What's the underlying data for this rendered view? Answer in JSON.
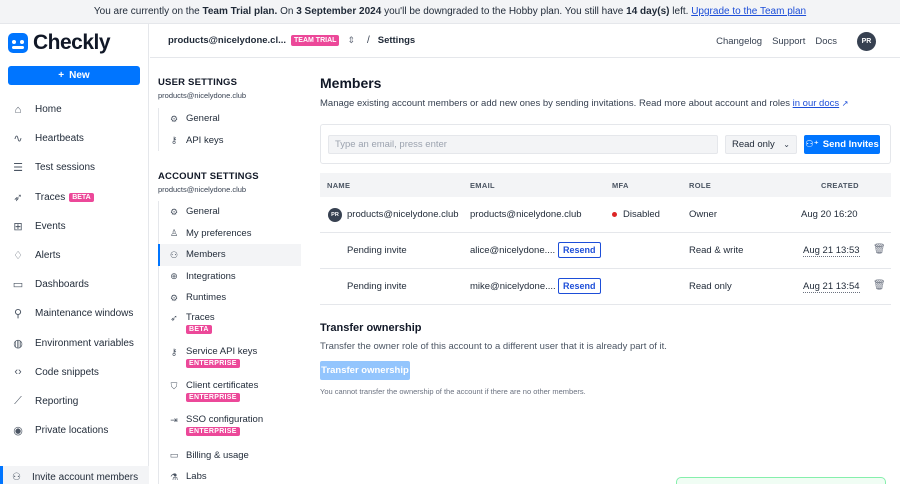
{
  "banner": {
    "prefix": "You are currently on the",
    "plan": "Team Trial plan.",
    "on": "On",
    "date": "3 September 2024",
    "middle": "you'll be downgraded to the Hobby plan. You still have",
    "days": "14 day(s)",
    "left": "left.",
    "upgrade_link": "Upgrade to the Team plan"
  },
  "brand": {
    "name": "Checkly"
  },
  "sidebar": {
    "new_label": "New",
    "items": [
      {
        "label": "Home",
        "icon": "home-icon"
      },
      {
        "label": "Heartbeats",
        "icon": "heartbeat-icon"
      },
      {
        "label": "Test sessions",
        "icon": "test-sessions-icon"
      },
      {
        "label": "Traces",
        "icon": "traces-icon",
        "badge": "BETA"
      },
      {
        "label": "Events",
        "icon": "events-icon"
      },
      {
        "label": "Alerts",
        "icon": "bell-icon"
      },
      {
        "label": "Dashboards",
        "icon": "dashboard-icon"
      },
      {
        "label": "Maintenance windows",
        "icon": "maintenance-icon"
      },
      {
        "label": "Environment variables",
        "icon": "globe-icon"
      },
      {
        "label": "Code snippets",
        "icon": "code-icon"
      },
      {
        "label": "Reporting",
        "icon": "chart-icon"
      },
      {
        "label": "Private locations",
        "icon": "location-icon"
      }
    ],
    "bottom": {
      "label": "Invite account members",
      "icon": "invite-user-icon"
    }
  },
  "header": {
    "account": "products@nicelydone.cl...",
    "trial_badge": "TEAM TRIAL",
    "separator": "/",
    "breadcrumb": "Settings",
    "links": [
      "Changelog",
      "Support",
      "Docs"
    ],
    "avatar": "PR"
  },
  "subnav": {
    "user_title": "USER SETTINGS",
    "user_email": "products@nicelydone.club",
    "user_items": [
      {
        "label": "General",
        "icon": "gear-icon"
      },
      {
        "label": "API keys",
        "icon": "key-icon"
      }
    ],
    "account_title": "ACCOUNT SETTINGS",
    "account_email": "products@nicelydone.club",
    "account_items": [
      {
        "label": "General",
        "icon": "gear-icon"
      },
      {
        "label": "My preferences",
        "icon": "user-icon"
      },
      {
        "label": "Members",
        "icon": "members-icon",
        "active": true
      },
      {
        "label": "Integrations",
        "icon": "integrations-icon"
      },
      {
        "label": "Runtimes",
        "icon": "runtimes-icon"
      },
      {
        "label": "Traces",
        "icon": "traces-icon",
        "badge": "BETA"
      },
      {
        "label": "Service API keys",
        "icon": "key-icon",
        "badge": "ENTERPRISE"
      },
      {
        "label": "Client certificates",
        "icon": "certificate-icon",
        "badge": "ENTERPRISE"
      },
      {
        "label": "SSO configuration",
        "icon": "sso-icon",
        "badge": "ENTERPRISE"
      },
      {
        "label": "Billing & usage",
        "icon": "credit-card-icon"
      },
      {
        "label": "Labs",
        "icon": "labs-icon"
      }
    ]
  },
  "members": {
    "title": "Members",
    "description": "Manage existing account members or add new ones by sending invitations. Read more about account and roles",
    "docs_link": "in our docs",
    "email_placeholder": "Type an email, press enter",
    "role_selected": "Read only",
    "send_label": "Send Invites",
    "columns": {
      "name": "NAME",
      "email": "EMAIL",
      "mfa": "MFA",
      "role": "ROLE",
      "created": "CREATED"
    },
    "rows": [
      {
        "avatar": "PR",
        "name": "products@nicelydone.club",
        "email": "products@nicelydone.club",
        "mfa": "Disabled",
        "role": "Owner",
        "created": "Aug 20 16:20"
      },
      {
        "name": "Pending invite",
        "email": "alice@nicelydone....",
        "resend": "Resend",
        "role": "Read & write",
        "created": "Aug 21 13:53"
      },
      {
        "name": "Pending invite",
        "email": "mike@nicelydone....",
        "resend": "Resend",
        "role": "Read only",
        "created": "Aug 21 13:54"
      }
    ]
  },
  "transfer": {
    "title": "Transfer ownership",
    "description": "Transfer the owner role of this account to a different user that it is already part of it.",
    "button": "Transfer ownership",
    "note": "You cannot transfer the ownership of the account if there are no other members."
  },
  "colors": {
    "accent": "#0075ff",
    "badge": "#ec4899",
    "danger": "#dc2626"
  }
}
